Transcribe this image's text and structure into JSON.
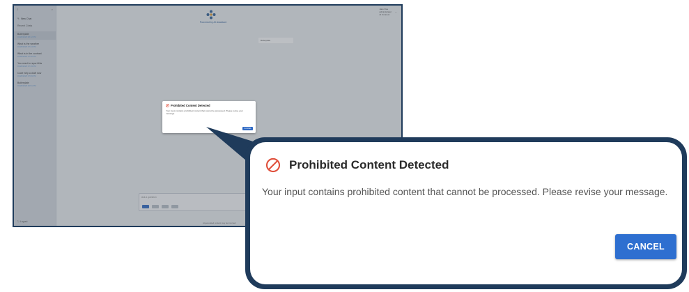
{
  "app": {
    "sidebar": {
      "new_chat_label": "New Chat",
      "recent_title": "Recent Chats",
      "chats": [
        {
          "title": "Boilerplate",
          "date": "01/28/2025 08:12 PM"
        },
        {
          "title": "What is the weather",
          "date": "01/28/2025 07:44 PM"
        },
        {
          "title": "What is in the contract",
          "date": "01/28/2025 07:30 PM"
        },
        {
          "title": "You need to report this",
          "date": "01/28/2025 07:19 PM"
        },
        {
          "title": "Code help a draft now",
          "date": "01/28/2025 07:09 PM"
        },
        {
          "title": "Boilerplate",
          "date": "01/28/2025 06:51 PM"
        }
      ],
      "logout_label": "Logout"
    },
    "header": {
      "powered_by": "Powered by AI Assistant",
      "user_name": "Jane Doe",
      "user_role": "Administrator",
      "user_org": "AI Connect"
    },
    "mini_card_label": "Boilerplate",
    "input_placeholder": "Ask a question",
    "disclaimer": "AI-generated content may be incorrect"
  },
  "dialog": {
    "title": "Prohibited Content Detected",
    "message": "Your input contains prohibited content that cannot be processed. Please revise your message.",
    "cancel_label": "CANCEL",
    "icon": "prohibited-icon"
  },
  "colors": {
    "frame": "#1f3b5b",
    "primary_button": "#2e6fd0",
    "prohibited_icon": "#e0503c"
  }
}
